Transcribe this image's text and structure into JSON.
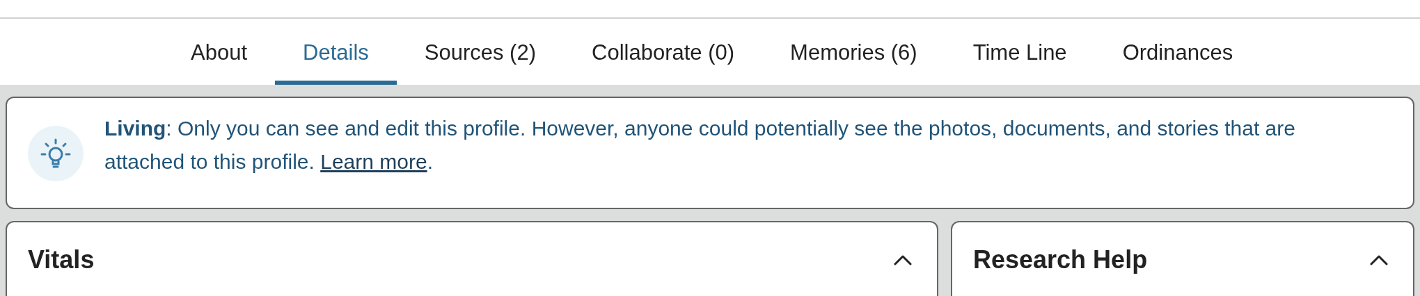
{
  "tabs": [
    {
      "label": "About",
      "selected": false
    },
    {
      "label": "Details",
      "selected": true
    },
    {
      "label": "Sources (2)",
      "selected": false
    },
    {
      "label": "Collaborate (0)",
      "selected": false
    },
    {
      "label": "Memories (6)",
      "selected": false
    },
    {
      "label": "Time Line",
      "selected": false
    },
    {
      "label": "Ordinances",
      "selected": false
    }
  ],
  "notice": {
    "text": "**Living**: Only you can see and edit this profile. However, anyone could potentially see the photos, documents, and stories that are attached to this profile.",
    "link": "Learn more",
    "after_link": "."
  },
  "cards": [
    {
      "title": "Vitals",
      "expanded": true
    },
    {
      "title": "Research Help",
      "expanded": true
    }
  ]
}
